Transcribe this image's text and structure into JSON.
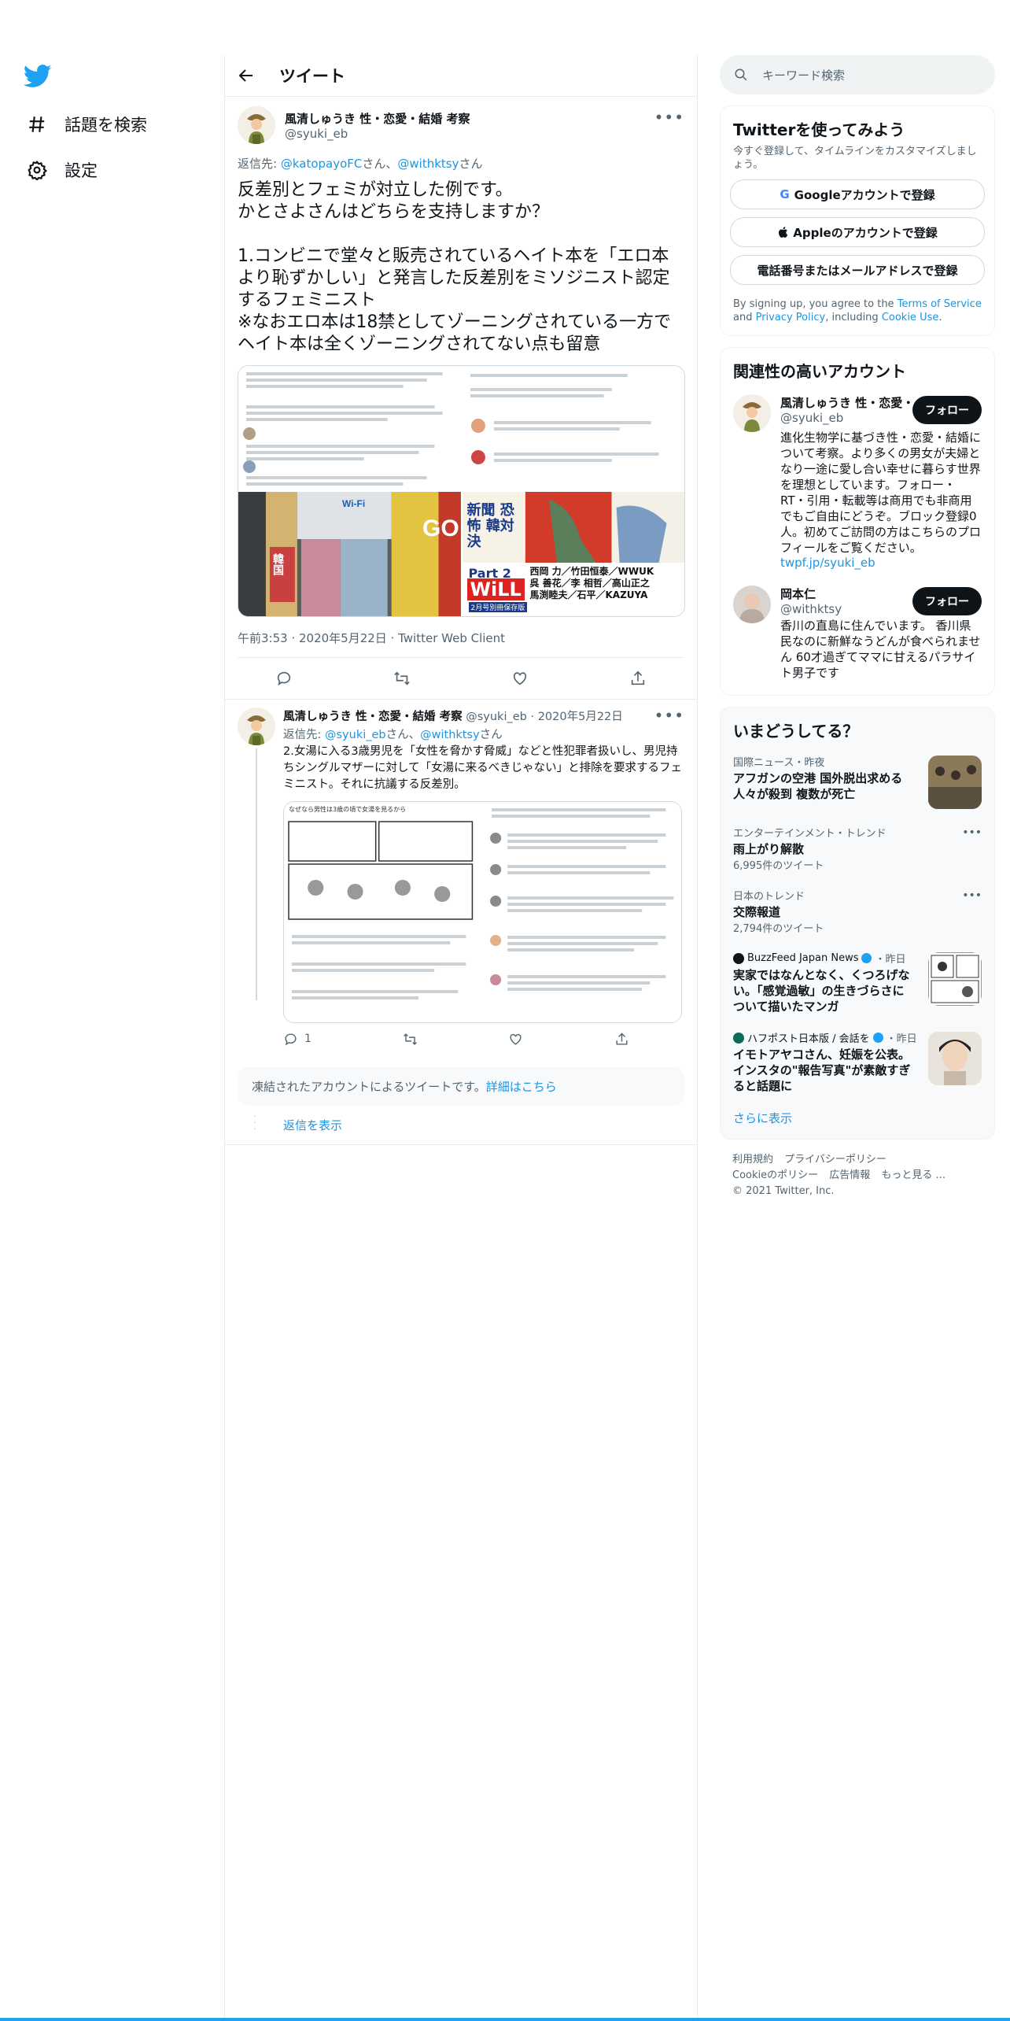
{
  "nav": {
    "explore_label": "話題を検索",
    "settings_label": "設定"
  },
  "header": {
    "title": "ツイート"
  },
  "main_tweet": {
    "author_name": "風清しゅうき 性・恋愛・結婚 考察",
    "author_handle": "@syuki_eb",
    "reply_prefix": "返信先:",
    "reply_user1": "@katopayoFC",
    "reply_san1": "さん、",
    "reply_user2": "@withktsy",
    "reply_san2": "さん",
    "text": "反差別とフェミが対立した例です。\nかとさよさんはどちらを支持しますか？\n\n1.コンビニで堂々と販売されているヘイト本を「エロ本より恥ずかしい」と発言した反差別をミソジニスト認定するフェミニスト\n※なおエロ本は18禁としてゾーニングされている一方でヘイト本は全くゾーニングされてない点も留意",
    "timestamp": "午前3:53 · 2020年5月22日 · Twitter Web Client",
    "image_texts": {
      "mag_title": "WiLL",
      "mag_part": "Part 2",
      "mag_issue": "2月号別冊保存版",
      "mag_authors": "西岡 力／竹田恒泰／WWUK\n呉 善花／李 相哲／高山正之\n馬渕睦夫／石平／KAZUYA",
      "mag_side": "新聞 恐怖 韓対決",
      "store_label": "GO",
      "wifi_label": "Wi-Fi",
      "side_text": "韓国"
    }
  },
  "reply_tweet": {
    "author_name": "風清しゅうき 性・恋愛・結婚 考察",
    "author_handle": "@syuki_eb",
    "date": "2020年5月22日",
    "reply_prefix": "返信先:",
    "reply_user1": "@syuki_eb",
    "reply_san1": "さん、",
    "reply_user2": "@withktsy",
    "reply_san2": "さん",
    "text": "2.女湯に入る3歳男児を「女性を脅かす脅威」などと性犯罪者扱いし、男児持ちシングルマザーに対して「女湯に来るべきじゃない」と排除を要求するフェミニスト。それに抗議する反差別。",
    "manga_title": "なぜなら男性は3歳の頃で女湯を見るから",
    "reply_count": "1"
  },
  "notice": {
    "text": "凍結されたアカウントによるツイートです。",
    "link": "詳細はこちら"
  },
  "show_replies": "返信を表示",
  "search": {
    "placeholder": "キーワード検索"
  },
  "signup": {
    "title": "Twitterを使ってみよう",
    "subtitle": "今すぐ登録して、タイムラインをカスタマイズしましょう。",
    "google": "Googleアカウントで登録",
    "apple": "Appleのアカウントで登録",
    "phone": "電話番号またはメールアドレスで登録",
    "legal_1": "By signing up, you agree to the ",
    "legal_tos": "Terms of Service",
    "legal_2": " and ",
    "legal_pp": "Privacy Policy",
    "legal_3": ", including ",
    "legal_cookie": "Cookie Use",
    "legal_4": "."
  },
  "related": {
    "title": "関連性の高いアカウント",
    "accounts": [
      {
        "name": "風清しゅうき 性・恋愛・",
        "handle": "@syuki_eb",
        "follow": "フォロー",
        "bio": "進化生物学に基づき性・恋愛・結婚について考察。より多くの男女が夫婦となり一途に愛し合い幸せに暮らす世界を理想としています。フォロー・RT・引用・転載等は商用でも非商用でもご自由にどうぞ。ブロック登録0人。初めてご訪問の方はこちらのプロフィールをご覧ください。",
        "link": "twpf.jp/syuki_eb"
      },
      {
        "name": "岡本仁",
        "handle": "@withktsy",
        "follow": "フォロー",
        "bio": "香川の直島に住んでいます。 香川県民なのに新鮮なうどんが食べられません 60才過ぎてママに甘えるパラサイト男子です"
      }
    ]
  },
  "trends": {
    "title": "いまどうしてる？",
    "items": [
      {
        "context": "国際ニュース・昨夜",
        "title": "アフガンの空港 国外脱出求める人々が殺到 複数が死亡"
      },
      {
        "context": "エンターテインメント・トレンド",
        "title": "雨上がり解散",
        "count": "6,995件のツイート"
      },
      {
        "context": "日本のトレンド",
        "title": "交際報道",
        "count": "2,794件のツイート"
      },
      {
        "source": "BuzzFeed Japan News",
        "time": "・昨日",
        "title": "実家ではなんとなく、くつろげない。「感覚過敏」の生きづらさについて描いたマンガ"
      },
      {
        "source": "ハフポスト日本版 / 会話を",
        "time": "・昨日",
        "title": "イモトアヤコさん、妊娠を公表。インスタの\"報告写真\"が素敵すぎると話題に"
      }
    ],
    "show_more": "さらに表示"
  },
  "footer": {
    "terms": "利用規約",
    "privacy": "プライバシーポリシー",
    "cookie": "Cookieのポリシー",
    "ads": "広告情報",
    "more": "もっと見る ...",
    "copyright": "© 2021 Twitter, Inc."
  },
  "colors": {
    "accent": "#1da1f2",
    "link": "#1b95e0",
    "follow_bg": "#0f1419"
  }
}
